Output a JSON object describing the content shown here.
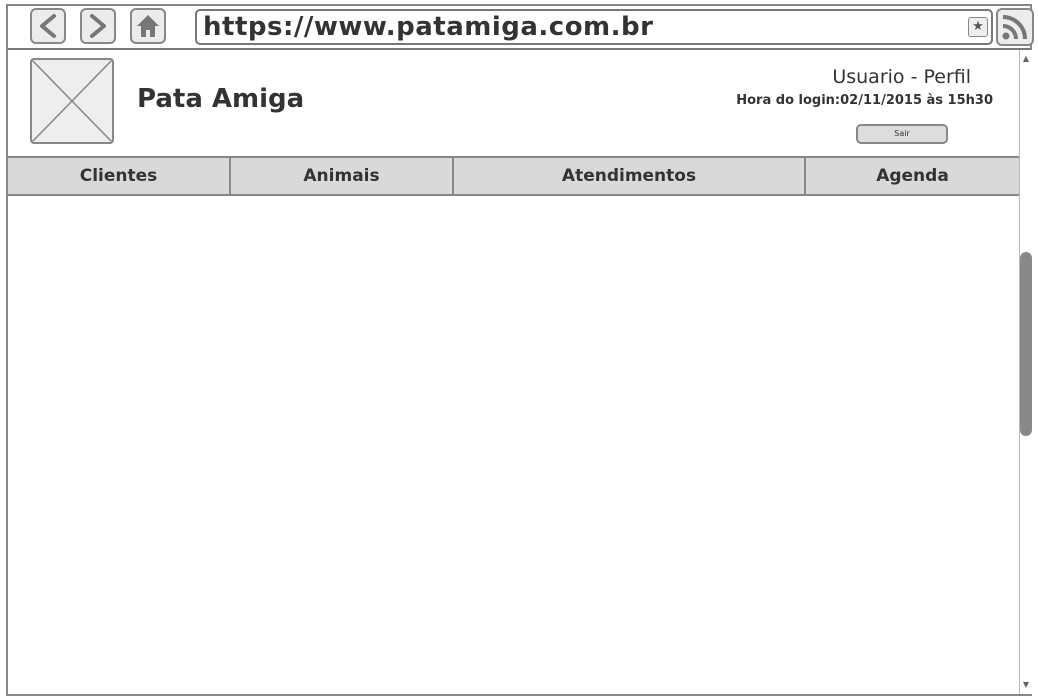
{
  "browser": {
    "url": "https://www.patamiga.com.br",
    "back_icon": "chevron-left-icon",
    "forward_icon": "chevron-right-icon",
    "home_icon": "home-icon",
    "bookmark_icon": "star-icon",
    "rss_icon": "rss-icon"
  },
  "header": {
    "site_title": "Pata Amiga",
    "logo_icon": "image-placeholder-icon",
    "user_profile": "Usuario - Perfil",
    "login_time": "Hora do login:02/11/2015 às 15h30",
    "logout_label": "Sair"
  },
  "nav": {
    "tabs": [
      {
        "label": "Clientes"
      },
      {
        "label": "Animais"
      },
      {
        "label": "Atendimentos"
      },
      {
        "label": "Agenda"
      }
    ]
  },
  "colors": {
    "border": "#888888",
    "tab_background": "#d9d9d9",
    "text": "#333333",
    "scroll_thumb": "#888888"
  }
}
